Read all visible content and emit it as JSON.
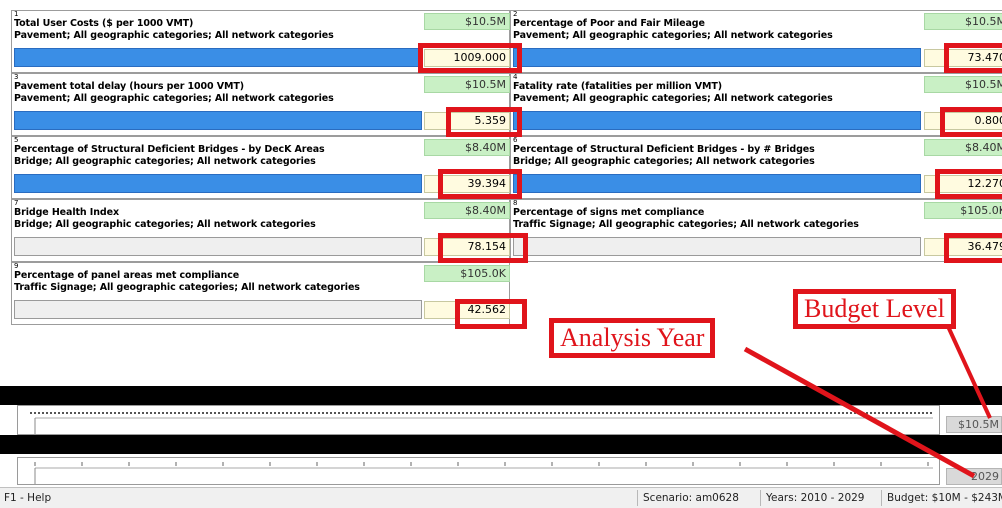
{
  "panels": [
    {
      "index": "1",
      "title": "Total User Costs ($ per 1000 VMT)",
      "subtitle": "Pavement; All geographic categories; All network categories",
      "budget": "$10.5M",
      "value": "1009.000",
      "bar_color": "blue"
    },
    {
      "index": "2",
      "title": "Percentage of Poor and Fair Mileage",
      "subtitle": "Pavement; All geographic categories; All network categories",
      "budget": "$10.5M",
      "value": "73.470",
      "bar_color": "blue"
    },
    {
      "index": "3",
      "title": "Pavement total delay (hours per 1000 VMT)",
      "subtitle": "Pavement; All geographic categories; All network categories",
      "budget": "$10.5M",
      "value": "5.359",
      "bar_color": "blue"
    },
    {
      "index": "4",
      "title": "Fatality rate (fatalities per million VMT)",
      "subtitle": "Pavement; All geographic categories; All network categories",
      "budget": "$10.5M",
      "value": "0.800",
      "bar_color": "blue"
    },
    {
      "index": "5",
      "title": "Percentage of Structural Deficient Bridges - by DecK Areas",
      "subtitle": "Bridge; All geographic categories; All network categories",
      "budget": "$8.40M",
      "value": "39.394",
      "bar_color": "blue"
    },
    {
      "index": "6",
      "title": "Percentage of Structural Deficient Bridges - by # Bridges",
      "subtitle": "Bridge; All geographic categories; All network categories",
      "budget": "$8.40M",
      "value": "12.270",
      "bar_color": "blue"
    },
    {
      "index": "7",
      "title": "Bridge Health Index",
      "subtitle": "Bridge; All geographic categories; All network categories",
      "budget": "$8.40M",
      "value": "78.154",
      "bar_color": "gray"
    },
    {
      "index": "8",
      "title": "Percentage of signs met compliance",
      "subtitle": "Traffic Signage; All geographic categories; All network categories",
      "budget": "$105.0K",
      "value": "36.479",
      "bar_color": "gray"
    },
    {
      "index": "9",
      "title": "Percentage of panel areas met compliance",
      "subtitle": "Traffic Signage; All geographic categories; All network categories",
      "budget": "$105.0K",
      "value": "42.562",
      "bar_color": "gray"
    }
  ],
  "sliders": {
    "budget_value": "$10.5M",
    "year_value": "2029"
  },
  "callouts": {
    "budget_level": "Budget Level",
    "analysis_year": "Analysis Year"
  },
  "status": {
    "help": "F1 - Help",
    "scenario": "Scenario: am0628",
    "years": "Years: 2010 - 2029",
    "budget": "Budget: $10M - $243M"
  },
  "colors": {
    "bar_blue": "#3a8ee6",
    "budget_green": "#c9f0c5",
    "value_yellow": "#fffbe0",
    "annotation_red": "#e0141b"
  }
}
